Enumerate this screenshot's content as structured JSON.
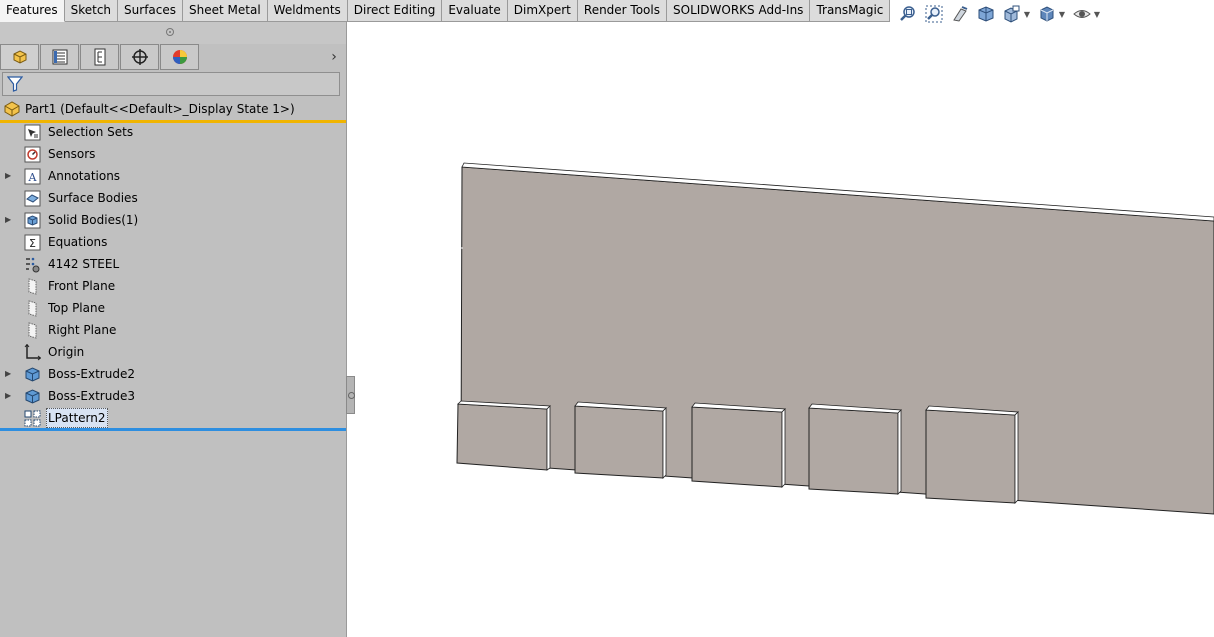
{
  "command_tabs": [
    {
      "label": "Features",
      "active": true
    },
    {
      "label": "Sketch",
      "active": false
    },
    {
      "label": "Surfaces",
      "active": false
    },
    {
      "label": "Sheet Metal",
      "active": false
    },
    {
      "label": "Weldments",
      "active": false
    },
    {
      "label": "Direct Editing",
      "active": false
    },
    {
      "label": "Evaluate",
      "active": false
    },
    {
      "label": "DimXpert",
      "active": false
    },
    {
      "label": "Render Tools",
      "active": false
    },
    {
      "label": "SOLIDWORKS Add-Ins",
      "active": false
    },
    {
      "label": "TransMagic",
      "active": false
    }
  ],
  "hud_icons": [
    "zoom-to-fit-icon",
    "zoom-to-area-icon",
    "previous-view-icon",
    "section-view-icon",
    "view-orientation-icon",
    "display-style-icon",
    "hide-show-items-icon"
  ],
  "feature_manager": {
    "tabs": [
      "feature-manager-icon",
      "property-manager-icon",
      "configuration-manager-icon",
      "dimxpert-manager-icon",
      "display-manager-icon"
    ],
    "root_label": "Part1  (Default<<Default>_Display State 1>)",
    "items": [
      {
        "label": "Selection Sets",
        "icon": "selection-sets-icon",
        "expandable": false
      },
      {
        "label": "Sensors",
        "icon": "sensors-icon",
        "expandable": false
      },
      {
        "label": "Annotations",
        "icon": "annotations-icon",
        "expandable": true
      },
      {
        "label": "Surface Bodies",
        "icon": "surface-bodies-icon",
        "expandable": false
      },
      {
        "label": "Solid Bodies(1)",
        "icon": "solid-bodies-icon",
        "expandable": true
      },
      {
        "label": "Equations",
        "icon": "equations-icon",
        "expandable": false
      },
      {
        "label": "4142 STEEL",
        "icon": "material-icon",
        "expandable": false
      },
      {
        "label": "Front Plane",
        "icon": "plane-icon",
        "expandable": false
      },
      {
        "label": "Top Plane",
        "icon": "plane-icon",
        "expandable": false
      },
      {
        "label": "Right Plane",
        "icon": "plane-icon",
        "expandable": false
      },
      {
        "label": "Origin",
        "icon": "origin-icon",
        "expandable": false
      },
      {
        "label": "Boss-Extrude2",
        "icon": "boss-extrude-icon",
        "expandable": true
      },
      {
        "label": "Boss-Extrude3",
        "icon": "boss-extrude-icon",
        "expandable": true
      },
      {
        "label": "LPattern2",
        "icon": "linear-pattern-icon",
        "expandable": false,
        "selected": true
      }
    ]
  },
  "colors": {
    "panel_bg": "#c0c0c0",
    "model_face": "#b0a8a3",
    "rollback_orange": "#f0b400",
    "rollback_blue": "#2d8ee0",
    "viewport_bg": "#ffffff"
  }
}
